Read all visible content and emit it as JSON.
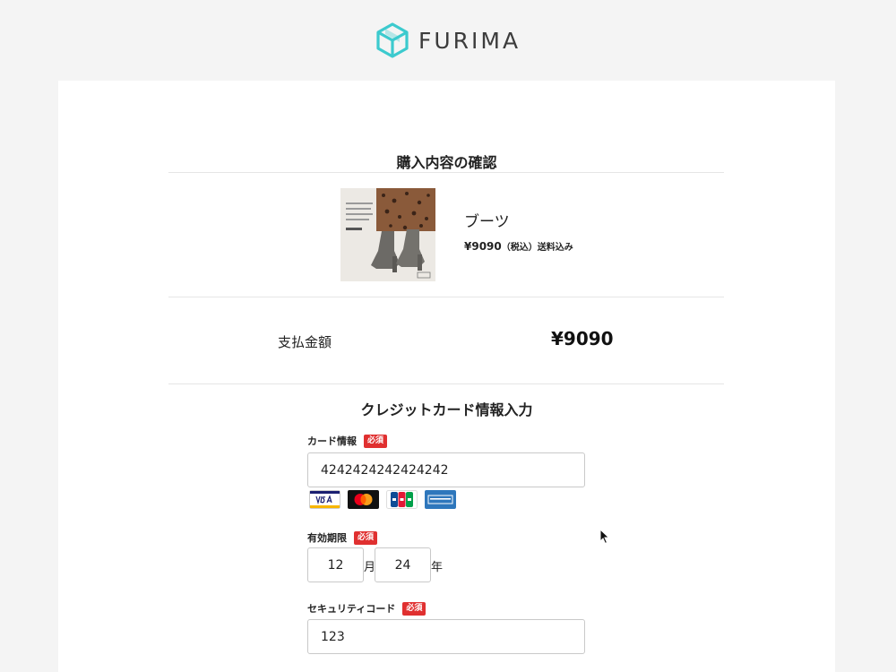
{
  "header": {
    "brand": "FURIMA",
    "logo_icon": "cube-logo-icon",
    "brand_color": "#3ccace"
  },
  "confirm": {
    "title": "購入内容の確認",
    "item": {
      "image_icon": "boots-product-photo",
      "name": "ブーツ",
      "price": "¥9090",
      "price_note": "（税込）送料込み"
    }
  },
  "payment": {
    "label": "支払金額",
    "amount": "¥9090"
  },
  "card_form": {
    "title": "クレジットカード情報入力",
    "required_badge": "必須",
    "card_info": {
      "label": "カード情報",
      "value": "4242424242424242"
    },
    "brands": [
      "VISA",
      "Mastercard",
      "JCB",
      "AMERICAN EXPRESS"
    ],
    "expiry": {
      "label": "有効期限",
      "month": "12",
      "month_unit": "月",
      "year": "24",
      "year_unit": "年"
    },
    "security": {
      "label": "セキュリティコード",
      "value": "123"
    }
  },
  "colors": {
    "required": "#e03030",
    "background": "#f4f4f4",
    "panel": "#ffffff"
  }
}
